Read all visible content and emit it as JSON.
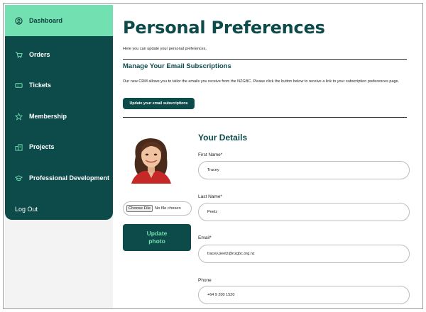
{
  "sidebar": {
    "items": [
      {
        "label": "Dashboard",
        "icon": "user-circle-icon",
        "active": true
      },
      {
        "label": "Orders",
        "icon": "cart-icon",
        "active": false
      },
      {
        "label": "Tickets",
        "icon": "ticket-icon",
        "active": false
      },
      {
        "label": "Membership",
        "icon": "star-icon",
        "active": false
      },
      {
        "label": "Projects",
        "icon": "buildings-icon",
        "active": false
      },
      {
        "label": "Professional Development",
        "icon": "graduation-cap-icon",
        "active": false
      }
    ],
    "logout_label": "Log Out"
  },
  "main": {
    "title": "Personal Preferences",
    "intro": "Here you can update your personal preferences.",
    "email_section": {
      "title": "Manage Your Email Subscriptions",
      "text": "Our new CRM allows you to tailor the emails you receive from the NZGBC. Please click the button below to receive a link to your subscription preferences page.",
      "button_label": "Update your email subscriptions"
    },
    "photo": {
      "choose_file_label": "Choose File",
      "no_file_text": "No file chosen",
      "update_label_line1": "Update",
      "update_label_line2": "photo"
    },
    "details": {
      "title": "Your Details",
      "fields": [
        {
          "label": "First Name*",
          "value": "Tracey"
        },
        {
          "label": "Last Name*",
          "value": "Peetz"
        },
        {
          "label": "Email*",
          "value": "tracey.peetz@nzgbc.org.nz"
        },
        {
          "label": "Phone",
          "value": "+64 9 200 1520"
        }
      ]
    }
  },
  "colors": {
    "sidebar": "#0d4a4a",
    "accent": "#72e0b0",
    "title": "#0d4a4a"
  }
}
